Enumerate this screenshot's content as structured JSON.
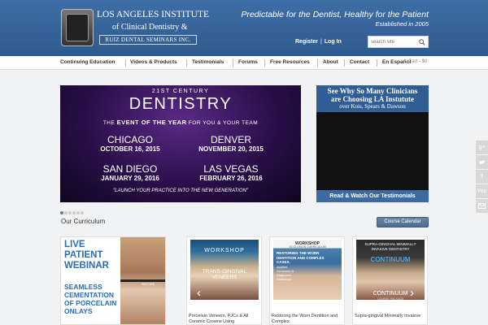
{
  "header": {
    "logo": {
      "line1": "LOS ANGELES INSTITUTE",
      "line2": "of Clinical Dentistry &",
      "line3": "RUIZ DENTAL SEMINARS INC."
    },
    "tagline": "Predictable for the Dentist, Healthy for the Patient",
    "established": "Established in 2005",
    "register": "Register",
    "separator": "|",
    "login": "Log In",
    "search_placeholder": "search site"
  },
  "nav": {
    "items": [
      "Continuing Education",
      "Videos & Products",
      "Testimonials",
      "Forums",
      "Free Resources",
      "About",
      "Contact",
      "En Español"
    ],
    "cart": "Cart - $0"
  },
  "hero": {
    "century": "21ST CENTURY",
    "title": "DENTISTRY",
    "event_pre": "THE",
    "event_bold": "EVENT OF THE YEAR",
    "event_post": "FOR YOU & YOUR TEAM",
    "cities": [
      {
        "name": "CHICAGO",
        "date": "OCTOBER 16, 2015"
      },
      {
        "name": "DENVER",
        "date": "NOVEMBER 20, 2015"
      },
      {
        "name": "SAN DIEGO",
        "date": "JANUARY 29, 2016"
      },
      {
        "name": "LAS VEGAS",
        "date": "FEBRUARY 26, 2016"
      }
    ],
    "slogan": "\"LAUNCH YOUR PRACTICE INTO THE NEW GENERATION\"",
    "slide_count": 6,
    "active_slide": 1
  },
  "promo": {
    "heading1": "See Why So Many Clinicians",
    "heading2": "are Choosing LA Instutute",
    "subheading": "over Kois, Spears & Dawson",
    "button": "Read & Watch Our Testimonials"
  },
  "social": [
    "g+",
    "twitter-icon",
    "f",
    "You",
    "email-icon"
  ],
  "curriculum": {
    "title": "Our Curriculum",
    "calendar_button": "Course Calendar",
    "webinar": {
      "line1": "LIVE",
      "line2": "PATIENT",
      "line3": "WEBINAR",
      "line4": "SEAMLESS",
      "line5": "CEMENTATION",
      "line6": "OF PORCELAIN",
      "line7": "ONLAYS",
      "before_label": "BEFORE"
    },
    "cards": [
      {
        "banner": "WORKSHOP",
        "overlay": "TRANS-GINGIVAL VENEERS",
        "label": "Porcelain Veneers, PJCs & All Ceramic Crowns Using"
      },
      {
        "banner_top": "WORKSHOP",
        "banner_sub": "OCCLUSION CURRICULUM",
        "headline": "RESTORING THE WORN DENTITION AND COMPLEX CASES.",
        "detail": "Applied Occlusion & Diagnosis Workshop",
        "label": "Restoring the Worn Dentition and Complex"
      },
      {
        "banner": "SUPRA-GINGIVAL MINIMALLY INVASIVE DENTISTRY",
        "brand": "CONTINUUM",
        "overlay": "CONTINUUM",
        "overlay_sub": "COURSE PACKAGE",
        "label": "Supra-gingival Minimally Invasive"
      }
    ]
  },
  "colors": {
    "header_blue": "#2d5a8e",
    "accent_blue": "#2a6db4",
    "hero_purple": "#2a0f4a"
  }
}
